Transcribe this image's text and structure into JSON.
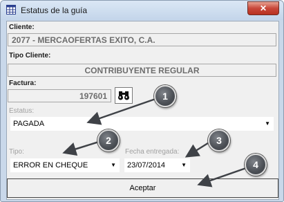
{
  "window": {
    "title": "Estatus de la guía",
    "close_glyph": "✕"
  },
  "cliente": {
    "label": "Cliente:",
    "value": "2077 - MERCAOFERTAS EXITO, C.A."
  },
  "tipo_cliente": {
    "label": "Tipo Cliente:",
    "value": "CONTRIBUYENTE REGULAR"
  },
  "factura": {
    "label": "Factura:",
    "value": "197601",
    "search_icon": "binoculars-icon"
  },
  "estatus": {
    "label": "Estatus:",
    "value": "PAGADA"
  },
  "tipo": {
    "label": "Tipo:",
    "value": "ERROR EN CHEQUE"
  },
  "fecha_entregada": {
    "label": "Fecha entregada:",
    "value": "23/07/2014"
  },
  "accept_label": "Aceptar",
  "callouts": [
    "1",
    "2",
    "3",
    "4"
  ],
  "colors": {
    "title_bar": "#c9d8ea",
    "close_button": "#c8483a",
    "callout": "#4b4f55"
  }
}
